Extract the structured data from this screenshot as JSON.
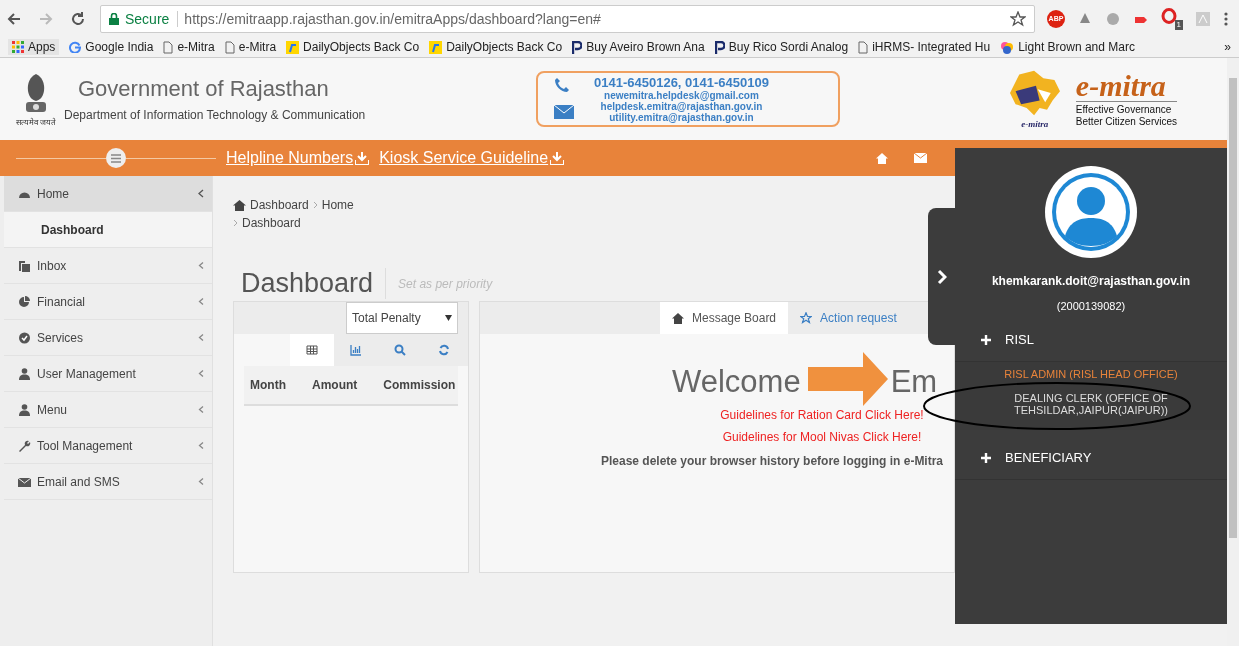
{
  "browser": {
    "secure_label": "Secure",
    "url": "https://emitraapp.rajasthan.gov.in/emitraApps/dashboard?lang=en#",
    "forward_disabled": true,
    "adblock_label": "ABP",
    "extension_badge": "1",
    "bookmarks": [
      {
        "kind": "apps",
        "label": "Apps"
      },
      {
        "kind": "google",
        "label": "Google India"
      },
      {
        "kind": "page",
        "label": "e-Mitra"
      },
      {
        "kind": "page",
        "label": "e-Mitra"
      },
      {
        "kind": "flipkart",
        "label": "DailyObjects Back Co"
      },
      {
        "kind": "flipkart",
        "label": "DailyObjects Back Co"
      },
      {
        "kind": "paytm",
        "label": "Buy Aveiro Brown Ana"
      },
      {
        "kind": "paytm",
        "label": "Buy Rico Sordi Analog"
      },
      {
        "kind": "page",
        "label": "iHRMS- Integrated Hu"
      },
      {
        "kind": "color",
        "label": "Light Brown and Marc"
      }
    ],
    "more": "»"
  },
  "header": {
    "title": "Government of Rajasthan",
    "subtitle": "Department of Information Technology & Communication",
    "emblem_motto": "सत्यमेव जयते",
    "contact": {
      "phones": "0141-6450126, 0141-6450109",
      "emails": [
        "newemitra.helpdesk@gmail.com",
        "helpdesk.emitra@rajasthan.gov.in",
        "utility.emitra@rajasthan.gov.in"
      ]
    },
    "brand": {
      "name": "e-mitra",
      "logo_caption": "e-mitra",
      "tagline": [
        "Effective Governance",
        "Better Citizen Services"
      ]
    }
  },
  "topbar": {
    "links": [
      "Helpline Numbers",
      "Kiosk Service Guideline"
    ]
  },
  "sidebar": {
    "items": [
      {
        "label": "Home",
        "kind": "dashboard",
        "expanded": true,
        "children": [
          {
            "label": "Dashboard"
          }
        ]
      },
      {
        "label": "Inbox",
        "kind": "inbox",
        "expanded": false
      },
      {
        "label": "Financial",
        "kind": "pie",
        "expanded": false
      },
      {
        "label": "Services",
        "kind": "check",
        "expanded": false
      },
      {
        "label": "User Management",
        "kind": "user",
        "expanded": false
      },
      {
        "label": "Menu",
        "kind": "user",
        "expanded": false
      },
      {
        "label": "Tool Management",
        "kind": "wrench",
        "expanded": false
      },
      {
        "label": "Email and SMS",
        "kind": "mail",
        "expanded": false
      }
    ]
  },
  "breadcrumb": [
    "Dashboard",
    "Home",
    "Dashboard"
  ],
  "page": {
    "title": "Dashboard",
    "subtitle": "Set as per priority"
  },
  "stats_panel": {
    "select": "Total Penalty",
    "tools": [
      {
        "kind": "table",
        "selected": true
      },
      {
        "kind": "chart",
        "selected": false
      },
      {
        "kind": "search",
        "selected": false
      },
      {
        "kind": "refresh",
        "selected": false
      }
    ],
    "columns": [
      "Month",
      "Amount",
      "Commission"
    ]
  },
  "message_panel": {
    "tabs": [
      {
        "label": "Message Board",
        "kind": "home",
        "selected": true
      },
      {
        "label": "Action request",
        "kind": "star",
        "selected": false
      }
    ],
    "welcome": [
      "Welcome",
      "Em"
    ],
    "links": [
      "Guidelines for Ration Card Click Here!",
      "Guidelines for Mool Nivas Click Here!"
    ],
    "notice": "Please delete your browser history before logging in e-Mitra"
  },
  "user_panel": {
    "email": "khemkarank.doit@rajasthan.gov.in",
    "id": "(2000139082)",
    "groups": [
      {
        "label": "RISL",
        "roles": [
          {
            "label": "RISL ADMIN (RISL HEAD OFFICE)",
            "selected": true,
            "circled": false
          },
          {
            "label": "DEALING CLERK (OFFICE OF TEHSILDAR,JAIPUR(JAIPUR))",
            "selected": false,
            "circled": true
          }
        ]
      },
      {
        "label": "BENEFICIARY"
      }
    ]
  }
}
